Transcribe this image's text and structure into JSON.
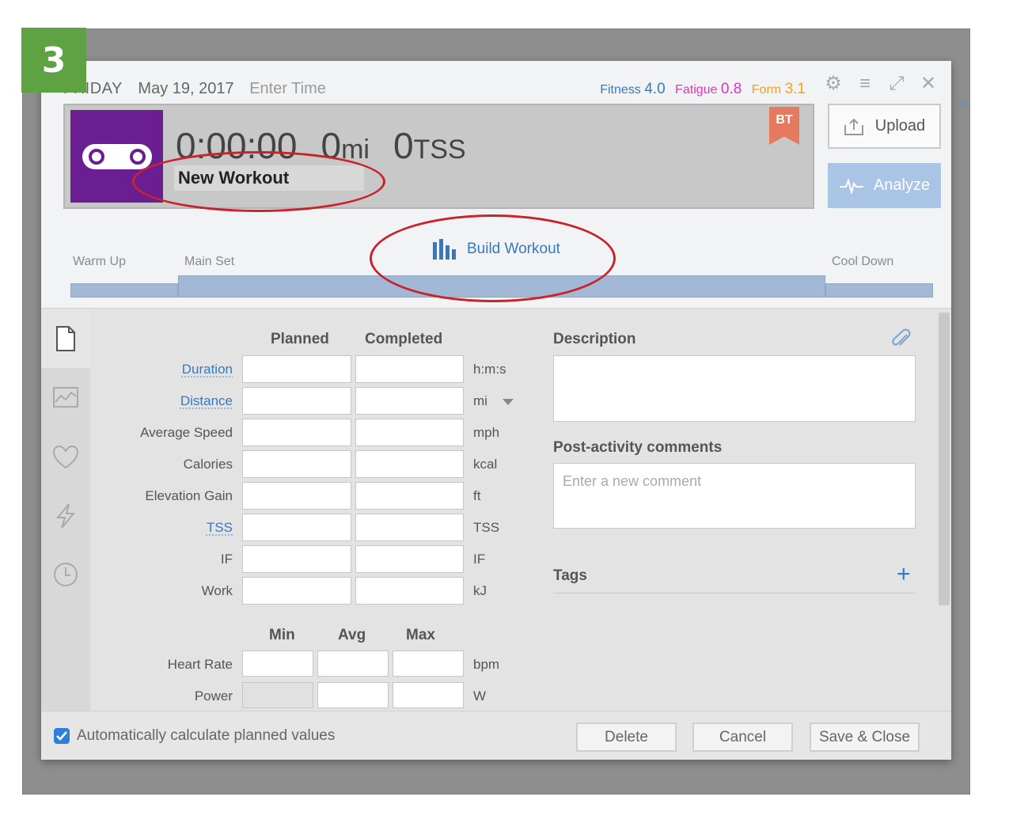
{
  "step_number": "3",
  "header": {
    "day_of_week": "FRIDAY",
    "date": "May 19, 2017",
    "enter_time": "Enter Time",
    "fitness_label": "Fitness",
    "fitness_value": "4.0",
    "fatigue_label": "Fatigue",
    "fatigue_value": "0.8",
    "form_label": "Form",
    "form_value": "3.1"
  },
  "workout": {
    "duration": "0:00:00",
    "distance_value": "0",
    "distance_unit": "mi",
    "tss_value": "0",
    "tss_unit": "TSS",
    "title": "New Workout",
    "badge": "BT",
    "sport_icon": "bike-chain-icon",
    "sport_color": "#6b1e92"
  },
  "buttons": {
    "upload": "Upload",
    "analyze": "Analyze",
    "build_workout": "Build Workout",
    "delete": "Delete",
    "cancel": "Cancel",
    "save_close": "Save & Close"
  },
  "phases": {
    "warm_up": "Warm Up",
    "main_set": "Main Set",
    "cool_down": "Cool Down"
  },
  "table": {
    "col_planned": "Planned",
    "col_completed": "Completed",
    "rows": [
      {
        "label": "Duration",
        "unit": "h:m:s",
        "link": true
      },
      {
        "label": "Distance",
        "unit": "mi",
        "link": true
      },
      {
        "label": "Average Speed",
        "unit": "mph",
        "link": false
      },
      {
        "label": "Calories",
        "unit": "kcal",
        "link": false
      },
      {
        "label": "Elevation Gain",
        "unit": "ft",
        "link": false
      },
      {
        "label": "TSS",
        "unit": "TSS",
        "link": true
      },
      {
        "label": "IF",
        "unit": "IF",
        "link": false
      },
      {
        "label": "Work",
        "unit": "kJ",
        "link": false
      }
    ]
  },
  "range_table": {
    "col_min": "Min",
    "col_avg": "Avg",
    "col_max": "Max",
    "rows": [
      {
        "label": "Heart Rate",
        "unit": "bpm"
      },
      {
        "label": "Power",
        "unit": "W"
      }
    ]
  },
  "right_panel": {
    "description_label": "Description",
    "comments_label": "Post-activity comments",
    "comments_placeholder": "Enter a new comment",
    "tags_label": "Tags"
  },
  "footer": {
    "auto_calc_label": "Automatically calculate planned values",
    "auto_calc_checked": true
  },
  "colors": {
    "accent_blue": "#3479c4",
    "fatigue_pink": "#e631c8",
    "form_orange": "#f2a21a",
    "step_green": "#5ea244",
    "annotation_red": "#c8232a"
  }
}
